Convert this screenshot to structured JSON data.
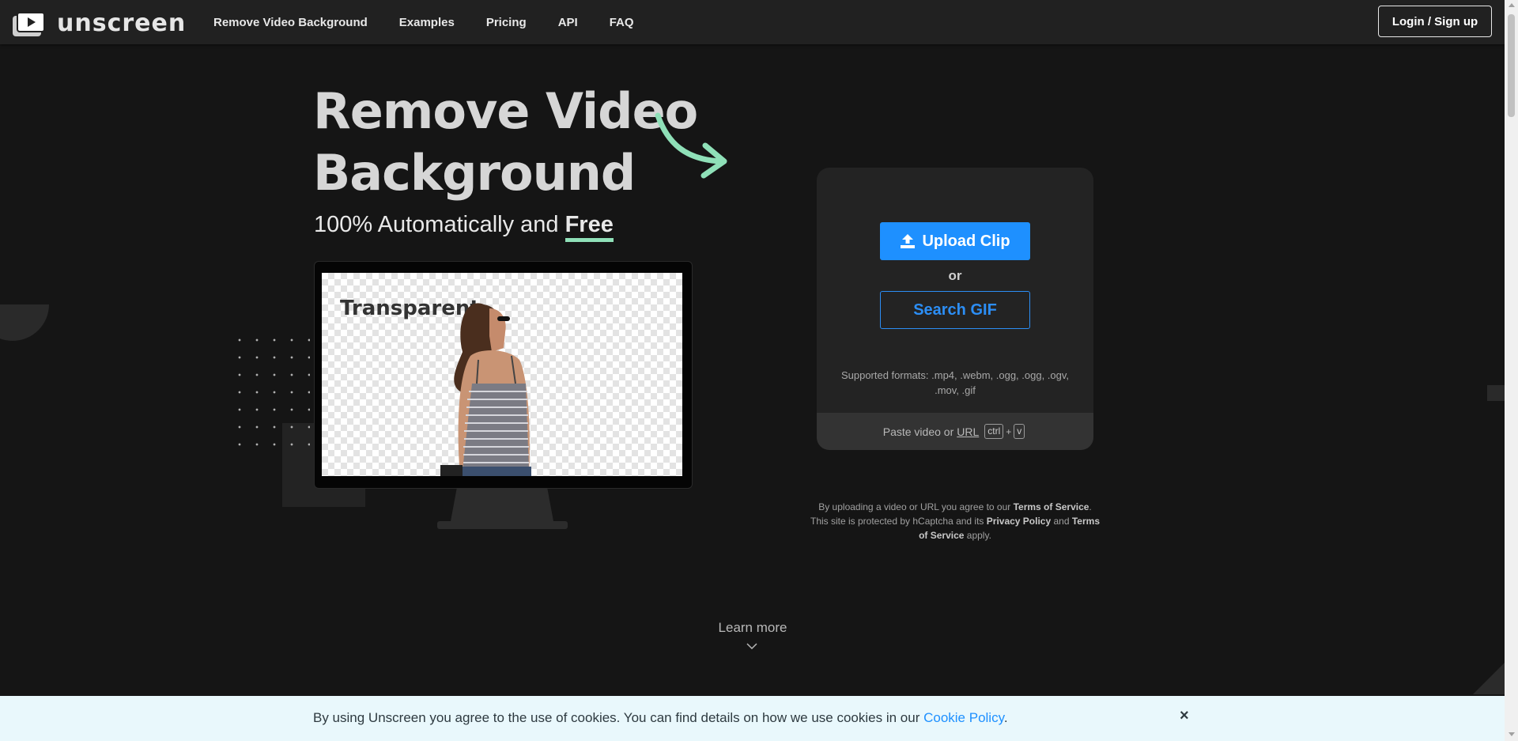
{
  "nav": {
    "logo_text": "unscreen",
    "links": [
      "Remove Video Background",
      "Examples",
      "Pricing",
      "API",
      "FAQ"
    ],
    "login_label": "Login / Sign up"
  },
  "hero": {
    "title": "Remove Video Background",
    "subtitle_prefix": "100% Automatically and ",
    "subtitle_emphasis": "Free",
    "preview_label": "Transparent"
  },
  "upload": {
    "upload_label": "Upload Clip",
    "or_label": "or",
    "search_label": "Search GIF",
    "formats_text": "Supported formats: .mp4, .webm, .ogg, .ogg, .ogv, .mov, .gif",
    "paste_prefix": "Paste video or",
    "paste_link": "URL",
    "key_ctrl": "ctrl",
    "key_plus": "+",
    "key_v": "v"
  },
  "terms": {
    "t1": "By uploading a video or URL you agree to our ",
    "tos": "Terms of Service",
    "t2": ". This site is protected by hCaptcha and its ",
    "privacy": "Privacy Policy",
    "t3": " and ",
    "tos2": "Terms of Service",
    "t4": " apply."
  },
  "learn_more": "Learn more",
  "cookie": {
    "text": "By using Unscreen you agree to the use of cookies. You can find details on how we use cookies in our ",
    "link": "Cookie Policy",
    "suffix": ".",
    "close": "×"
  },
  "colors": {
    "accent_blue": "#1e90ff",
    "accent_green": "#8fe0b8",
    "background": "#151515"
  },
  "icons": [
    "play-icon",
    "upload-icon",
    "arrow-icon",
    "chevron-down-icon",
    "close-icon"
  ]
}
